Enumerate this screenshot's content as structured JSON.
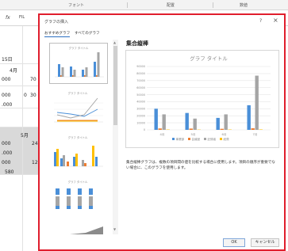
{
  "ribbon": {
    "groups": [
      "フォント",
      "配置",
      "数値"
    ]
  },
  "formula_bar": {
    "fx": "fx",
    "ref": "FIL"
  },
  "sheet": {
    "cells": [
      "15日",
      "4月",
      "000",
      "70",
      "000",
      "0",
      "30",
      ".000",
      "5月",
      "000",
      "24",
      ".000",
      "000",
      "12",
      "580"
    ]
  },
  "dialog": {
    "title": "グラフの挿入",
    "help": "?",
    "close": "×",
    "tabs": [
      "おすすめグラフ",
      "すべてのグラフ"
    ],
    "selected_type": "集合縦棒",
    "description": "集合縦棒グラフは、複数の項目間の値を比較する場合に使用します。項目の順序が重要でない場合に、このグラフを使用します。",
    "ok_label": "OK",
    "cancel_label": "キャンセル"
  },
  "thumb_titles": [
    "グラフ タイトル",
    "グラフ タイトル",
    "グラフ タイトル",
    "グラフ タイトル"
  ],
  "chart_data": {
    "type": "bar",
    "title": "グラフ タイトル",
    "categories": [
      "4月",
      "5月",
      "6月",
      "7月"
    ],
    "ylim": [
      0,
      90000
    ],
    "yticks": [
      "90000",
      "80000",
      "70000",
      "60000",
      "50000",
      "40000",
      "30000",
      "20000",
      "10000",
      "0"
    ],
    "series": [
      {
        "name": "事業部",
        "color": "#4a8fd8",
        "values": [
          30000,
          24000,
          17000,
          35000
        ]
      },
      {
        "name": "会議室",
        "color": "#ed7d31",
        "values": [
          2000,
          1800,
          1500,
          2200
        ]
      },
      {
        "name": "記録者",
        "color": "#a5a5a5",
        "values": [
          22000,
          16000,
          22000,
          77000
        ]
      },
      {
        "name": "経費",
        "color": "#ffc000",
        "values": [
          500,
          400,
          500,
          600
        ]
      }
    ],
    "legend": "bottom",
    "grid": true
  }
}
